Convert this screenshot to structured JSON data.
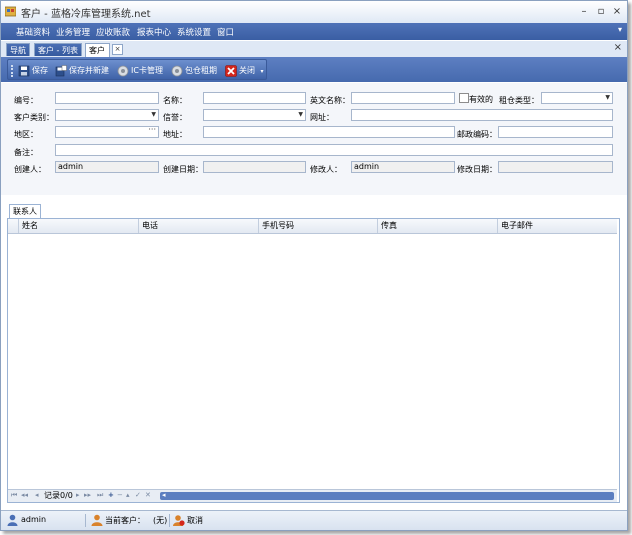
{
  "window": {
    "title": "客户 - 蓝格冷库管理系统.net"
  },
  "title_buttons": {
    "minimize": "–",
    "restore": "▫",
    "close": "×"
  },
  "menu": {
    "items": [
      "基础资料",
      "业务管理",
      "应收账款",
      "报表中心",
      "系统设置",
      "窗口"
    ],
    "overflow": "▾"
  },
  "tabs": [
    {
      "label": "导航"
    },
    {
      "label": "客户 - 列表"
    },
    {
      "label": "客户",
      "active": true,
      "close": "×"
    }
  ],
  "tabstrip_close": "×",
  "toolbar": {
    "save": "保存",
    "save_new": "保存并新建",
    "ic_card": "IC卡管理",
    "warehouse_rent": "包仓租期",
    "close": "关闭"
  },
  "form": {
    "code_label": "编号：",
    "name_label": "名称：",
    "english_name_label": "英文名称：",
    "valid_label": "有效的",
    "rent_type_label": "租仓类型：",
    "customer_type_label": "客户类别：",
    "credit_label": "信誉：",
    "website_label": "网址：",
    "area_label": "地区：",
    "address_label": "地址：",
    "postcode_label": "邮政编码：",
    "remark_label": "备注：",
    "creator_label": "创建人：",
    "creator_value": "admin",
    "created_date_label": "创建日期：",
    "modifier_label": "修改人：",
    "modifier_value": "admin",
    "modified_date_label": "修改日期：",
    "area_button": "···"
  },
  "contacts": {
    "tab_label": "联系人",
    "columns": [
      "姓名",
      "电话",
      "手机号码",
      "传真",
      "电子邮件"
    ],
    "nav_text": "记录0/0",
    "nav_first": "⏮",
    "nav_prev_page": "◂◂",
    "nav_prev": "◂",
    "nav_next": "▸",
    "nav_next_page": "▸▸",
    "nav_last": "⏭",
    "nav_add": "+",
    "nav_delete": "−",
    "nav_edit": "▴",
    "nav_confirm": "✓",
    "nav_cancel": "✕"
  },
  "statusbar": {
    "user": "admin",
    "current_customer_label": "当前客户：",
    "current_customer_value": "(无)",
    "cancel": "取消"
  },
  "colors": {
    "menu_bar": "#3f63a8",
    "toolbar": "#4a6eb0",
    "accent": "#5b7ec0"
  }
}
